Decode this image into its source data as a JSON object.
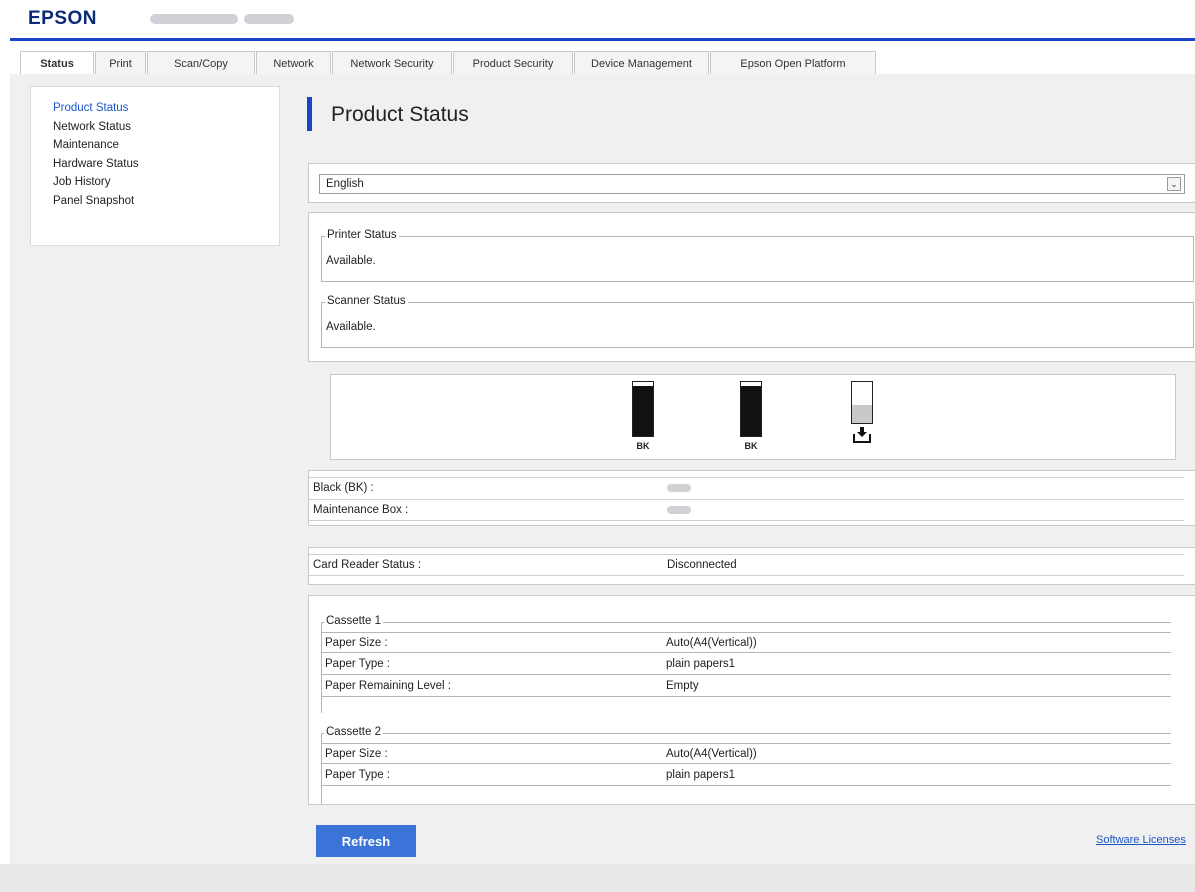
{
  "header": {
    "brand": "EPSON"
  },
  "tabs": [
    {
      "label": "Status",
      "width": 74
    },
    {
      "label": "Print",
      "width": 51
    },
    {
      "label": "Scan/Copy",
      "width": 108
    },
    {
      "label": "Network",
      "width": 75
    },
    {
      "label": "Network Security",
      "width": 120
    },
    {
      "label": "Product Security",
      "width": 120
    },
    {
      "label": "Device Management",
      "width": 135
    },
    {
      "label": "Epson Open Platform",
      "width": 166
    }
  ],
  "sidebar": {
    "items": [
      {
        "label": "Product Status"
      },
      {
        "label": "Network Status"
      },
      {
        "label": "Maintenance"
      },
      {
        "label": "Hardware Status"
      },
      {
        "label": "Job History"
      },
      {
        "label": "Panel Snapshot"
      }
    ]
  },
  "main": {
    "title": "Product Status",
    "language": {
      "selected": "English"
    },
    "printer_status": {
      "legend": "Printer Status",
      "value": "Available."
    },
    "scanner_status": {
      "legend": "Scanner Status",
      "value": "Available."
    },
    "ink": {
      "cartridges": [
        {
          "label": "BK",
          "level": 1.0
        },
        {
          "label": "BK",
          "level": 1.0
        }
      ],
      "maintenance_box": {
        "level": 0.45,
        "icon": "maintenance-box-icon"
      }
    },
    "info": {
      "black_label": "Black (BK) :",
      "maintenance_label": "Maintenance Box :"
    },
    "card_reader": {
      "label": "Card Reader Status :",
      "value": "Disconnected"
    },
    "cassettes": [
      {
        "legend": "Cassette 1",
        "rows": [
          {
            "k": "Paper Size :",
            "v": "Auto(A4(Vertical))"
          },
          {
            "k": "Paper Type :",
            "v": "plain papers1"
          },
          {
            "k": "Paper Remaining Level :",
            "v": "Empty"
          }
        ]
      },
      {
        "legend": "Cassette 2",
        "rows": [
          {
            "k": "Paper Size :",
            "v": "Auto(A4(Vertical))"
          },
          {
            "k": "Paper Type :",
            "v": "plain papers1"
          }
        ]
      }
    ],
    "refresh_label": "Refresh",
    "license_label": "Software Licenses"
  },
  "colors": {
    "accent": "#1a44c8",
    "link": "#1a56c7",
    "button": "#3a74d8"
  }
}
